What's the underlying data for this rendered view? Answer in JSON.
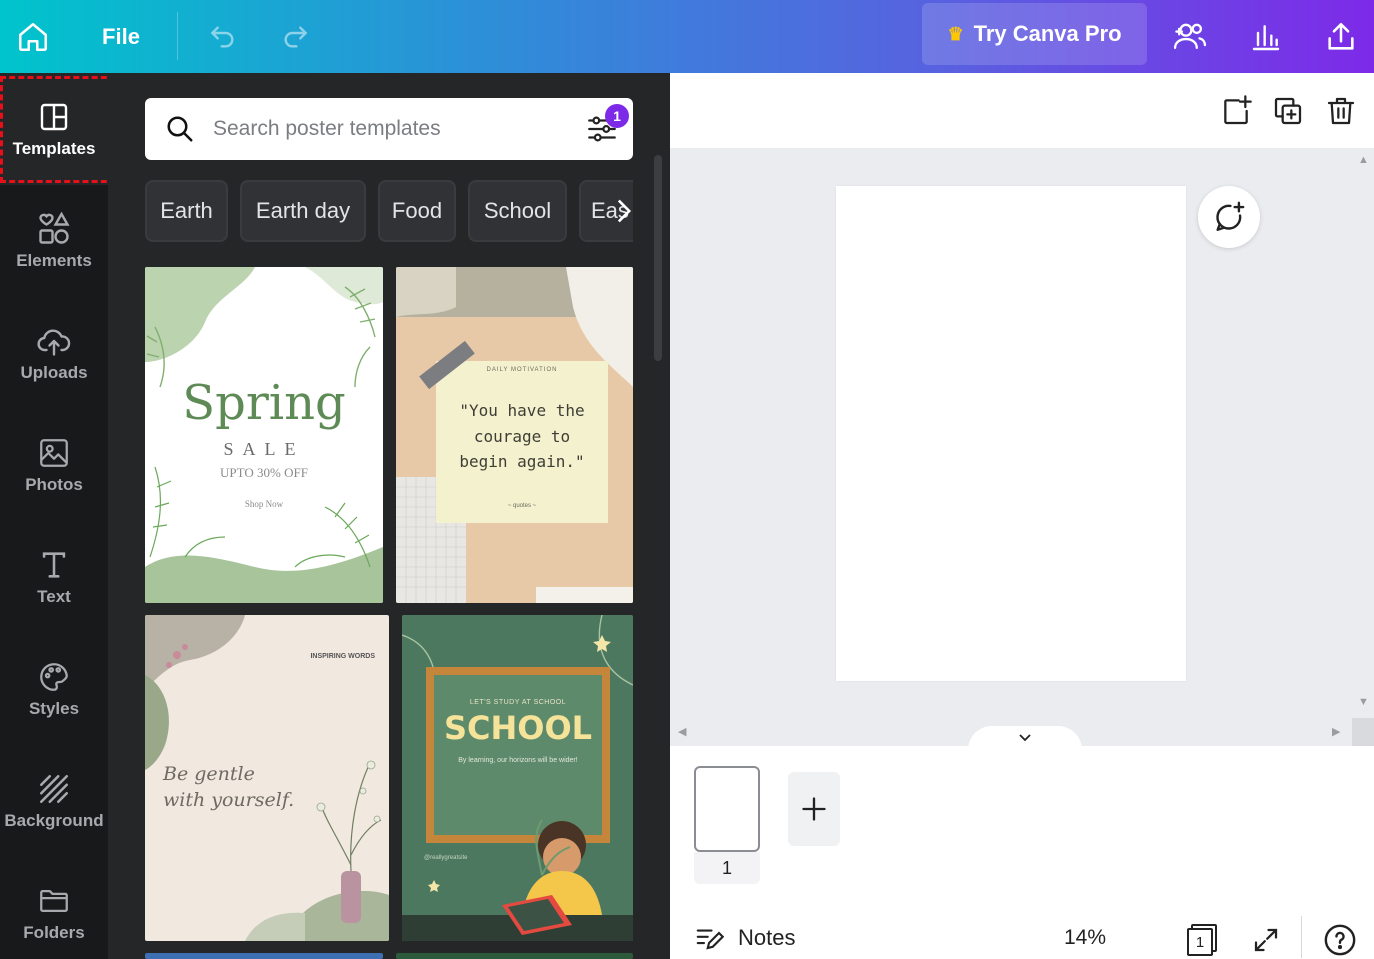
{
  "topbar": {
    "file_label": "File",
    "pro_label": "Try Canva Pro"
  },
  "rail": {
    "items": [
      {
        "label": "Templates"
      },
      {
        "label": "Elements"
      },
      {
        "label": "Uploads"
      },
      {
        "label": "Photos"
      },
      {
        "label": "Text"
      },
      {
        "label": "Styles"
      },
      {
        "label": "Background"
      },
      {
        "label": "Folders"
      }
    ]
  },
  "panel": {
    "search_placeholder": "Search poster templates",
    "filter_count": "1",
    "chips": [
      "Earth",
      "Earth day",
      "Food",
      "School",
      "Eas"
    ],
    "templates": {
      "spring": {
        "title": "Spring",
        "subtitle": "SALE",
        "offer": "UPTO 30% OFF",
        "cta": "Shop Now"
      },
      "quote": {
        "header": "DAILY MOTIVATION",
        "text_line1": "\"You have the",
        "text_line2": "courage to",
        "text_line3": "begin again.\"",
        "footer": "~ quotes ~"
      },
      "gentle": {
        "header": "INSPIRING WORDS",
        "text_line1": "Be gentle",
        "text_line2": "with yourself."
      },
      "school": {
        "kicker": "LET'S STUDY AT SCHOOL",
        "title": "SCHOOL",
        "body": "By learning, our horizons will be wider!",
        "handle": "@reallygreatsite"
      }
    }
  },
  "editor": {
    "page_number": "1",
    "notes_label": "Notes",
    "zoom": "14%",
    "page_count": "1"
  }
}
